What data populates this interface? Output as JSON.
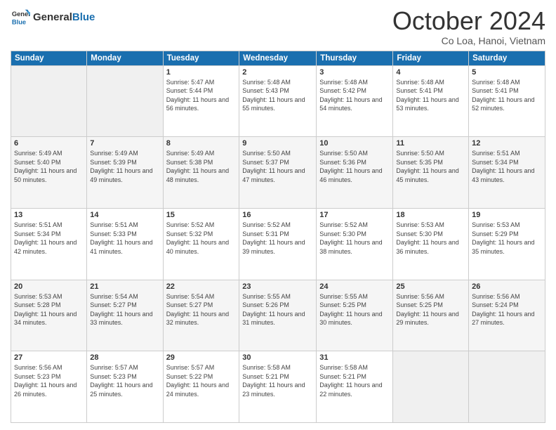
{
  "header": {
    "logo_general": "General",
    "logo_blue": "Blue",
    "month_title": "October 2024",
    "location": "Co Loa, Hanoi, Vietnam"
  },
  "days_of_week": [
    "Sunday",
    "Monday",
    "Tuesday",
    "Wednesday",
    "Thursday",
    "Friday",
    "Saturday"
  ],
  "weeks": [
    [
      {
        "day": "",
        "sunrise": "",
        "sunset": "",
        "daylight": ""
      },
      {
        "day": "",
        "sunrise": "",
        "sunset": "",
        "daylight": ""
      },
      {
        "day": "1",
        "sunrise": "Sunrise: 5:47 AM",
        "sunset": "Sunset: 5:44 PM",
        "daylight": "Daylight: 11 hours and 56 minutes."
      },
      {
        "day": "2",
        "sunrise": "Sunrise: 5:48 AM",
        "sunset": "Sunset: 5:43 PM",
        "daylight": "Daylight: 11 hours and 55 minutes."
      },
      {
        "day": "3",
        "sunrise": "Sunrise: 5:48 AM",
        "sunset": "Sunset: 5:42 PM",
        "daylight": "Daylight: 11 hours and 54 minutes."
      },
      {
        "day": "4",
        "sunrise": "Sunrise: 5:48 AM",
        "sunset": "Sunset: 5:41 PM",
        "daylight": "Daylight: 11 hours and 53 minutes."
      },
      {
        "day": "5",
        "sunrise": "Sunrise: 5:48 AM",
        "sunset": "Sunset: 5:41 PM",
        "daylight": "Daylight: 11 hours and 52 minutes."
      }
    ],
    [
      {
        "day": "6",
        "sunrise": "Sunrise: 5:49 AM",
        "sunset": "Sunset: 5:40 PM",
        "daylight": "Daylight: 11 hours and 50 minutes."
      },
      {
        "day": "7",
        "sunrise": "Sunrise: 5:49 AM",
        "sunset": "Sunset: 5:39 PM",
        "daylight": "Daylight: 11 hours and 49 minutes."
      },
      {
        "day": "8",
        "sunrise": "Sunrise: 5:49 AM",
        "sunset": "Sunset: 5:38 PM",
        "daylight": "Daylight: 11 hours and 48 minutes."
      },
      {
        "day": "9",
        "sunrise": "Sunrise: 5:50 AM",
        "sunset": "Sunset: 5:37 PM",
        "daylight": "Daylight: 11 hours and 47 minutes."
      },
      {
        "day": "10",
        "sunrise": "Sunrise: 5:50 AM",
        "sunset": "Sunset: 5:36 PM",
        "daylight": "Daylight: 11 hours and 46 minutes."
      },
      {
        "day": "11",
        "sunrise": "Sunrise: 5:50 AM",
        "sunset": "Sunset: 5:35 PM",
        "daylight": "Daylight: 11 hours and 45 minutes."
      },
      {
        "day": "12",
        "sunrise": "Sunrise: 5:51 AM",
        "sunset": "Sunset: 5:34 PM",
        "daylight": "Daylight: 11 hours and 43 minutes."
      }
    ],
    [
      {
        "day": "13",
        "sunrise": "Sunrise: 5:51 AM",
        "sunset": "Sunset: 5:34 PM",
        "daylight": "Daylight: 11 hours and 42 minutes."
      },
      {
        "day": "14",
        "sunrise": "Sunrise: 5:51 AM",
        "sunset": "Sunset: 5:33 PM",
        "daylight": "Daylight: 11 hours and 41 minutes."
      },
      {
        "day": "15",
        "sunrise": "Sunrise: 5:52 AM",
        "sunset": "Sunset: 5:32 PM",
        "daylight": "Daylight: 11 hours and 40 minutes."
      },
      {
        "day": "16",
        "sunrise": "Sunrise: 5:52 AM",
        "sunset": "Sunset: 5:31 PM",
        "daylight": "Daylight: 11 hours and 39 minutes."
      },
      {
        "day": "17",
        "sunrise": "Sunrise: 5:52 AM",
        "sunset": "Sunset: 5:30 PM",
        "daylight": "Daylight: 11 hours and 38 minutes."
      },
      {
        "day": "18",
        "sunrise": "Sunrise: 5:53 AM",
        "sunset": "Sunset: 5:30 PM",
        "daylight": "Daylight: 11 hours and 36 minutes."
      },
      {
        "day": "19",
        "sunrise": "Sunrise: 5:53 AM",
        "sunset": "Sunset: 5:29 PM",
        "daylight": "Daylight: 11 hours and 35 minutes."
      }
    ],
    [
      {
        "day": "20",
        "sunrise": "Sunrise: 5:53 AM",
        "sunset": "Sunset: 5:28 PM",
        "daylight": "Daylight: 11 hours and 34 minutes."
      },
      {
        "day": "21",
        "sunrise": "Sunrise: 5:54 AM",
        "sunset": "Sunset: 5:27 PM",
        "daylight": "Daylight: 11 hours and 33 minutes."
      },
      {
        "day": "22",
        "sunrise": "Sunrise: 5:54 AM",
        "sunset": "Sunset: 5:27 PM",
        "daylight": "Daylight: 11 hours and 32 minutes."
      },
      {
        "day": "23",
        "sunrise": "Sunrise: 5:55 AM",
        "sunset": "Sunset: 5:26 PM",
        "daylight": "Daylight: 11 hours and 31 minutes."
      },
      {
        "day": "24",
        "sunrise": "Sunrise: 5:55 AM",
        "sunset": "Sunset: 5:25 PM",
        "daylight": "Daylight: 11 hours and 30 minutes."
      },
      {
        "day": "25",
        "sunrise": "Sunrise: 5:56 AM",
        "sunset": "Sunset: 5:25 PM",
        "daylight": "Daylight: 11 hours and 29 minutes."
      },
      {
        "day": "26",
        "sunrise": "Sunrise: 5:56 AM",
        "sunset": "Sunset: 5:24 PM",
        "daylight": "Daylight: 11 hours and 27 minutes."
      }
    ],
    [
      {
        "day": "27",
        "sunrise": "Sunrise: 5:56 AM",
        "sunset": "Sunset: 5:23 PM",
        "daylight": "Daylight: 11 hours and 26 minutes."
      },
      {
        "day": "28",
        "sunrise": "Sunrise: 5:57 AM",
        "sunset": "Sunset: 5:23 PM",
        "daylight": "Daylight: 11 hours and 25 minutes."
      },
      {
        "day": "29",
        "sunrise": "Sunrise: 5:57 AM",
        "sunset": "Sunset: 5:22 PM",
        "daylight": "Daylight: 11 hours and 24 minutes."
      },
      {
        "day": "30",
        "sunrise": "Sunrise: 5:58 AM",
        "sunset": "Sunset: 5:21 PM",
        "daylight": "Daylight: 11 hours and 23 minutes."
      },
      {
        "day": "31",
        "sunrise": "Sunrise: 5:58 AM",
        "sunset": "Sunset: 5:21 PM",
        "daylight": "Daylight: 11 hours and 22 minutes."
      },
      {
        "day": "",
        "sunrise": "",
        "sunset": "",
        "daylight": ""
      },
      {
        "day": "",
        "sunrise": "",
        "sunset": "",
        "daylight": ""
      }
    ]
  ]
}
